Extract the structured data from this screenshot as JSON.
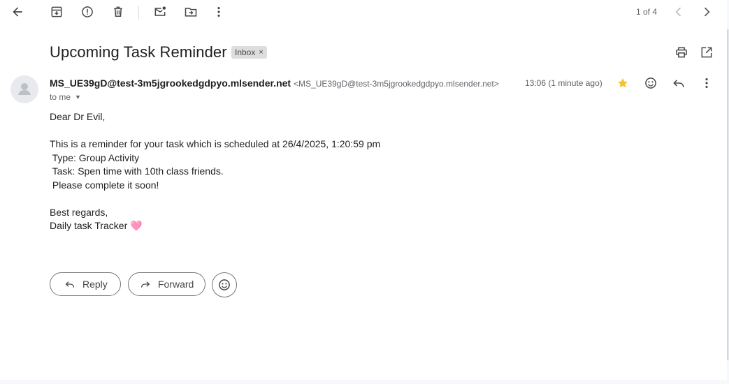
{
  "toolbar": {
    "pager_text": "1 of 4"
  },
  "email": {
    "subject": "Upcoming Task Reminder",
    "label": "Inbox",
    "label_remove": "×",
    "sender_name": "MS_UE39gD@test-3m5jgrookedgdpyo.mlsender.net",
    "sender_email": "<MS_UE39gD@test-3m5jgrookedgdpyo.mlsender.net>",
    "time": "13:06 (1 minute ago)",
    "to": "to me",
    "starred": true,
    "body_lines": [
      "Dear Dr Evil,",
      "",
      "This is a reminder for your task which is scheduled at 26/4/2025, 1:20:59 pm",
      " Type: Group Activity",
      " Task: Spen time with 10th class friends.",
      " Please complete it soon!",
      "",
      "Best regards,",
      "Daily task Tracker 🩷"
    ]
  },
  "actions": {
    "reply_label": "Reply",
    "forward_label": "Forward"
  },
  "colors": {
    "star": "#f4c430",
    "icon": "#444746"
  }
}
